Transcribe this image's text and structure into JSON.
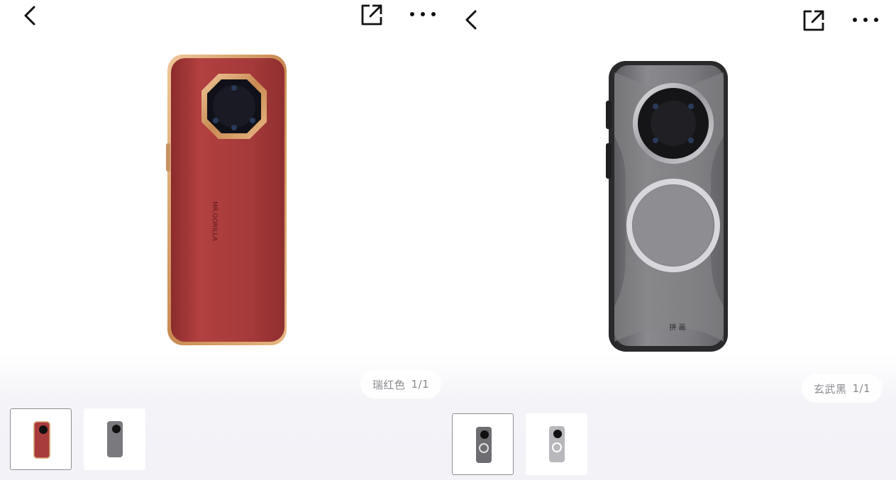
{
  "panels": [
    {
      "id": "left",
      "color_label": "瑞红色",
      "image_counter": "1/1",
      "brand_text": "MR.GORILLA",
      "case_color": "#a63a3a",
      "frame_color": "#d9a06a"
    },
    {
      "id": "right",
      "color_label": "玄武黑",
      "image_counter": "1/1",
      "brand_text": "拼 画",
      "case_color": "#7b7b7e",
      "frame_color": "#2b2b2b"
    }
  ],
  "icons": {
    "back": "chevron-left-icon",
    "share": "share-external-icon",
    "more": "more-horizontal-icon"
  }
}
